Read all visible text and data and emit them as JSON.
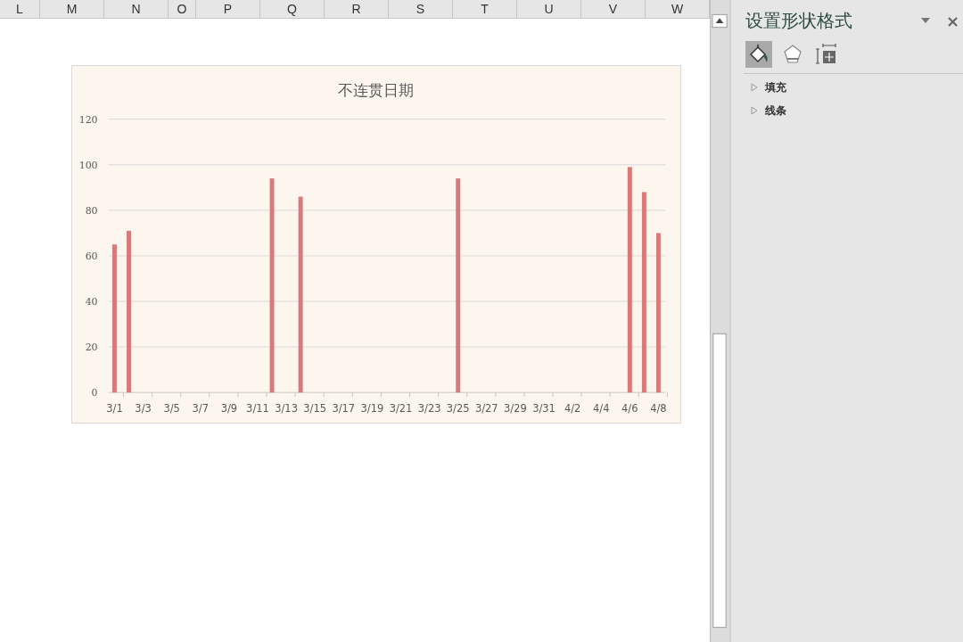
{
  "sheet": {
    "column_headers": [
      "L",
      "M",
      "N",
      "O",
      "P",
      "Q",
      "R",
      "S",
      "T",
      "U",
      "V",
      "W"
    ]
  },
  "chart": {
    "chart_data": {
      "type": "bar",
      "title": "不连贯日期",
      "categories": [
        "3/1",
        null,
        "3/3",
        null,
        "3/5",
        null,
        "3/7",
        null,
        "3/9",
        null,
        "3/11",
        null,
        "3/13",
        null,
        "3/15",
        null,
        "3/17",
        null,
        "3/19",
        null,
        "3/21",
        null,
        "3/23",
        null,
        "3/25",
        null,
        "3/27",
        null,
        "3/29",
        null,
        "3/31",
        null,
        "4/2",
        null,
        "4/4",
        null,
        "4/6",
        null,
        "4/8"
      ],
      "series": [
        {
          "color": "#d87a7a",
          "values": [
            65,
            71,
            null,
            null,
            null,
            null,
            null,
            null,
            null,
            null,
            null,
            94,
            null,
            86,
            null,
            null,
            null,
            null,
            null,
            null,
            null,
            null,
            null,
            null,
            94,
            null,
            null,
            null,
            null,
            null,
            null,
            null,
            null,
            null,
            null,
            null,
            99,
            88,
            70
          ]
        }
      ],
      "grid": true,
      "ylim": [
        0,
        120
      ],
      "yticks": [
        0,
        20,
        40,
        60,
        80,
        100,
        120
      ]
    }
  },
  "panel": {
    "title": "设置形状格式",
    "close": "×",
    "tabs": [
      {
        "kind": "fill",
        "selected": true
      },
      {
        "kind": "shape",
        "selected": false
      },
      {
        "kind": "size",
        "selected": false
      }
    ],
    "sections": [
      {
        "label": "填充",
        "expanded": false
      },
      {
        "label": "线条",
        "expanded": false
      }
    ]
  }
}
